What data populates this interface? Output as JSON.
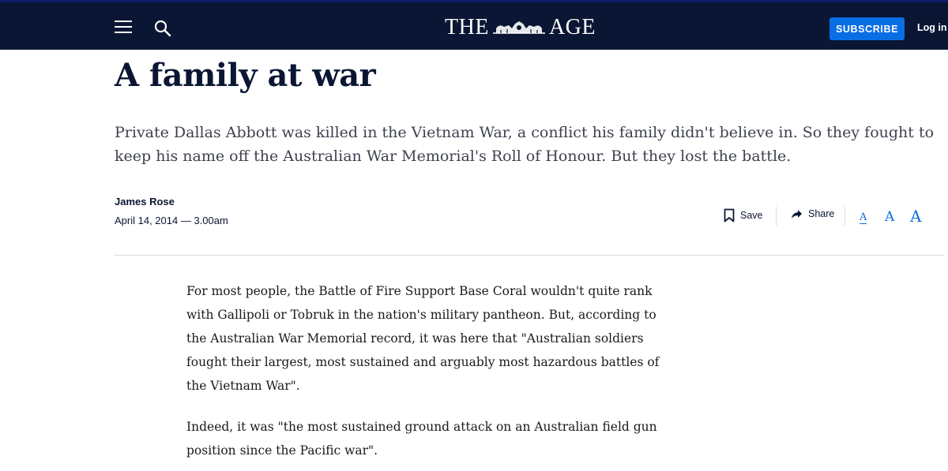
{
  "header": {
    "masthead_left": "THE",
    "masthead_right": "AGE",
    "subscribe_label": "SUBSCRIBE",
    "login_label": "Log in",
    "icons": [
      "menu-icon",
      "search-icon",
      "masthead-crest"
    ]
  },
  "article": {
    "headline": "A family at war",
    "standfirst": "Private Dallas Abbott was killed in the Vietnam War, a conflict his family didn't believe in. So they fought to keep his name off the Australian War Memorial's Roll of Honour. But they lost the battle.",
    "author": "James Rose",
    "date": "April 14, 2014 — 3.00am",
    "paragraphs": [
      "For most people, the Battle of Fire Support Base Coral wouldn't quite rank with Gallipoli or Tobruk in the nation's military pantheon. But, according to the Australian War Memorial record, it was here that \"Australian soldiers fought their largest, most sustained and arguably most hazardous battles of the Vietnam War\".",
      "Indeed, it was \"the most sustained ground attack on an Australian field gun position since the Pacific war\"."
    ]
  },
  "tools": {
    "save_label": "Save",
    "share_label": "Share",
    "font_small": "A",
    "font_medium": "A",
    "font_large": "A"
  },
  "colors": {
    "header_bg": "#0a1633",
    "accent": "#096de3",
    "text": "#0a1633"
  }
}
